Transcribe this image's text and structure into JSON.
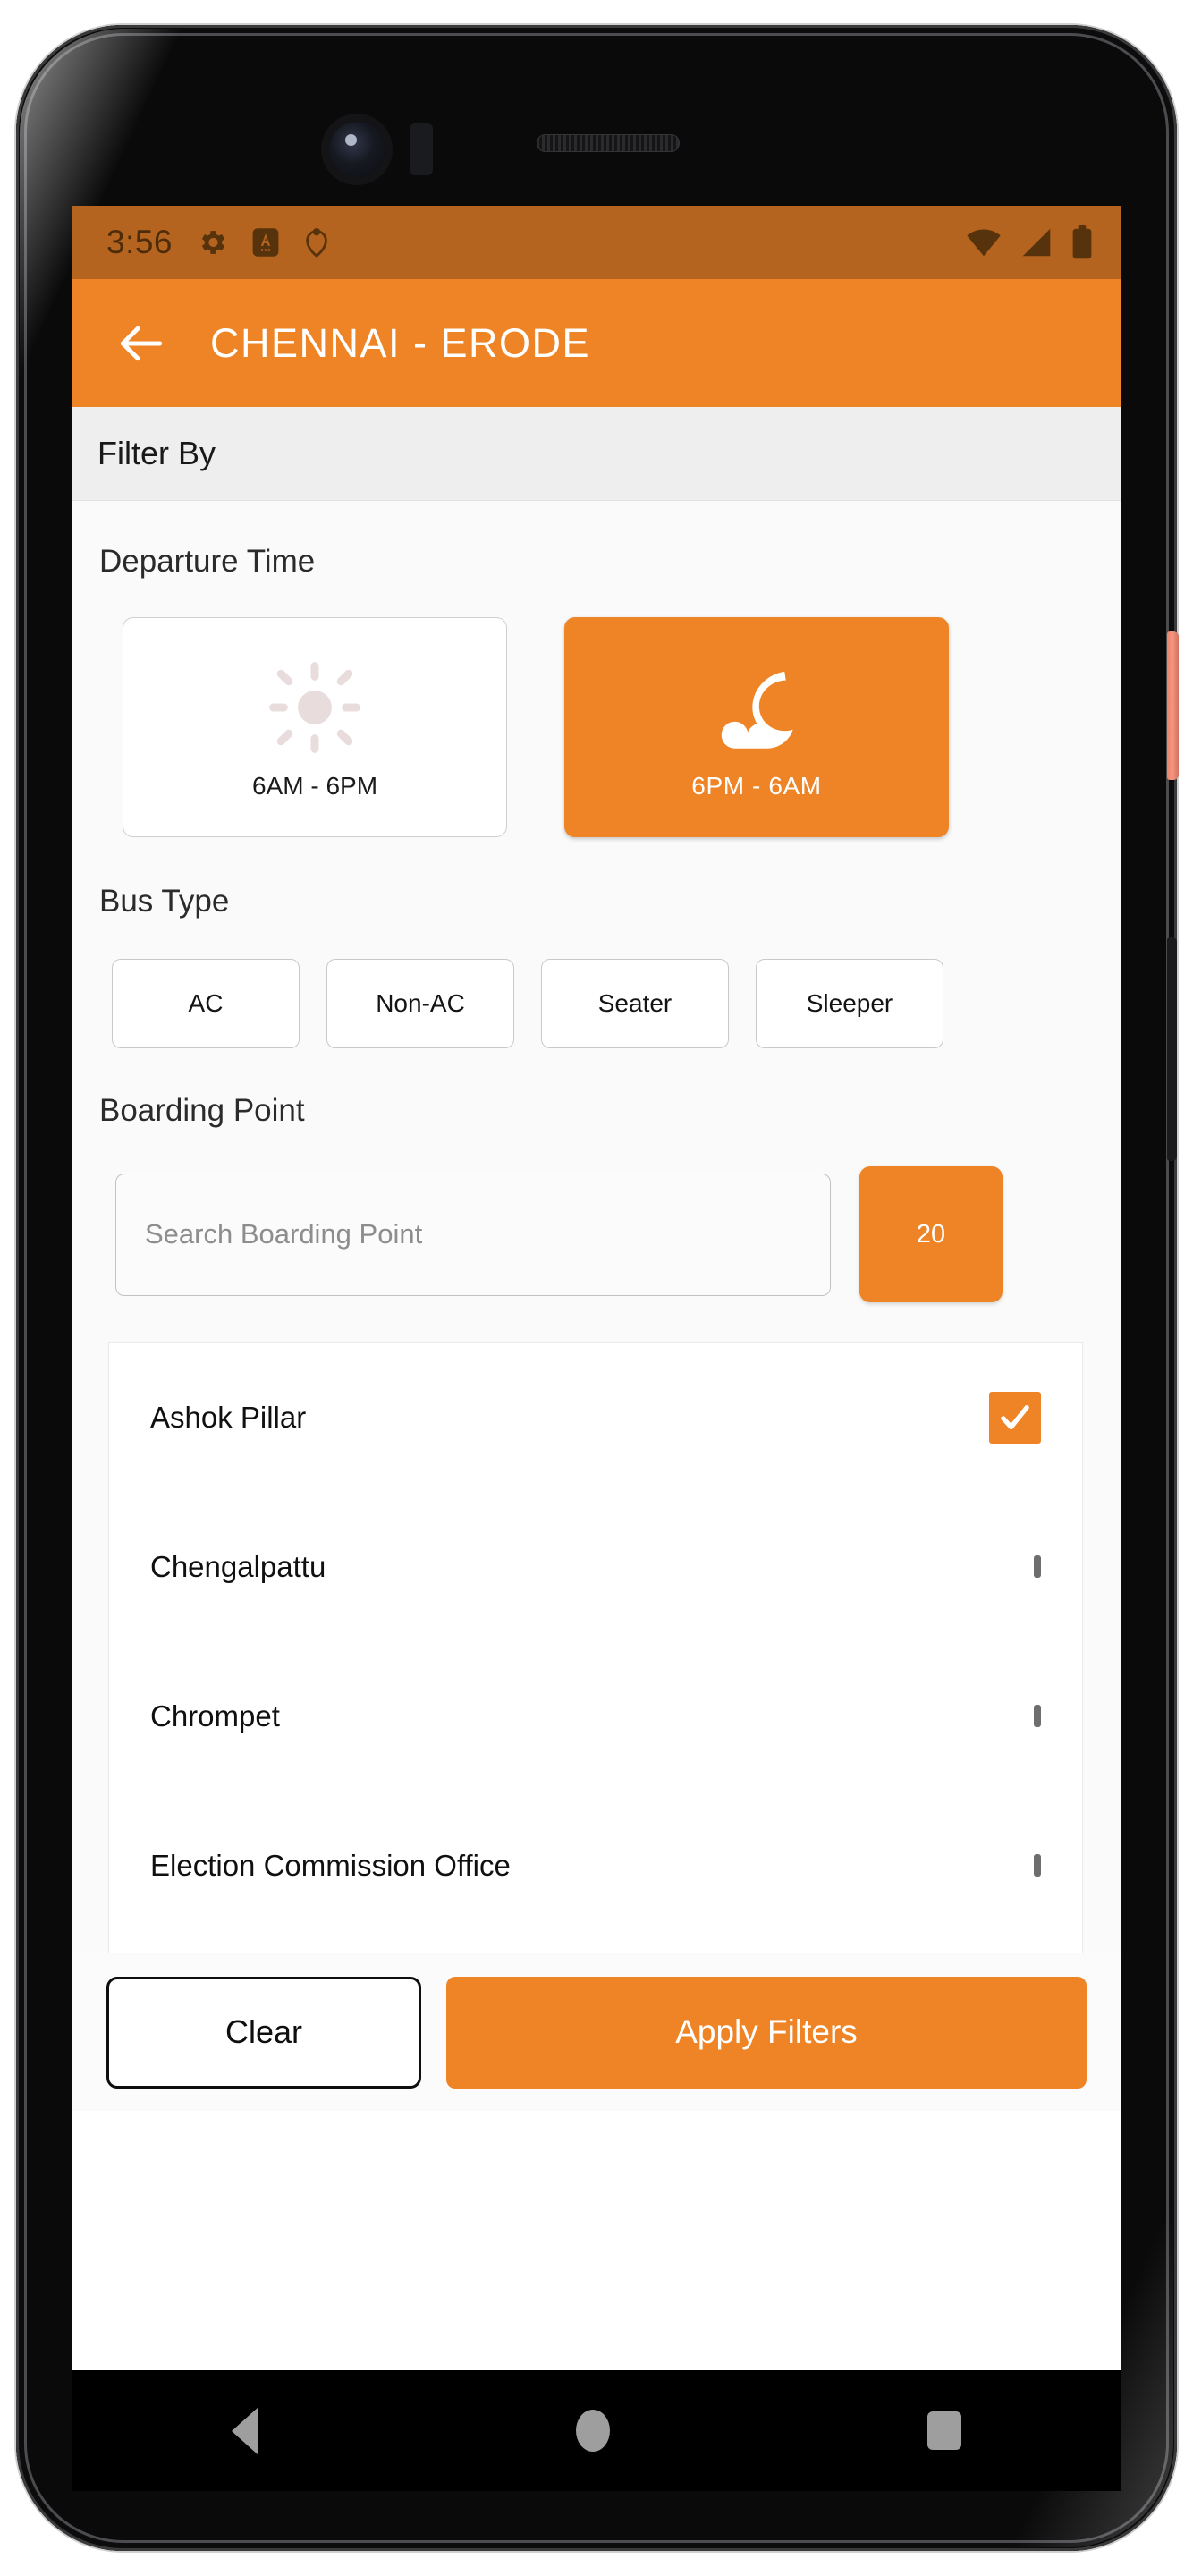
{
  "status_bar": {
    "time": "3:56",
    "left_icons": [
      "gear-icon",
      "android-auto-icon",
      "person-pin-icon"
    ],
    "right_icons": [
      "wifi-icon",
      "cellular-signal-icon",
      "battery-icon"
    ],
    "background_color": "#b4641e",
    "icon_color": "#56320d"
  },
  "app_bar": {
    "back_icon": "back-arrow-icon",
    "title": "CHENNAI - ERODE",
    "background_color": "#ee8425",
    "text_color": "#ffffff"
  },
  "filter_header": {
    "label": "Filter By",
    "background_color": "#eeeeee"
  },
  "departure_time": {
    "section_label": "Departure Time",
    "options": [
      {
        "label": "6AM - 6PM",
        "icon": "sun-icon",
        "selected": false
      },
      {
        "label": "6PM - 6AM",
        "icon": "moon-cloud-icon",
        "selected": true
      }
    ]
  },
  "bus_type": {
    "section_label": "Bus Type",
    "options": [
      {
        "label": "AC",
        "selected": false
      },
      {
        "label": "Non-AC",
        "selected": false
      },
      {
        "label": "Seater",
        "selected": false
      },
      {
        "label": "Sleeper",
        "selected": false
      }
    ]
  },
  "boarding_point": {
    "section_label": "Boarding Point",
    "search_placeholder": "Search Boarding Point",
    "search_value": "",
    "count_badge": "20",
    "items": [
      {
        "name": "Ashok Pillar",
        "checked": true
      },
      {
        "name": "Chengalpattu",
        "checked": false
      },
      {
        "name": "Chrompet",
        "checked": false
      },
      {
        "name": "Election Commission Office",
        "checked": false
      }
    ]
  },
  "actions": {
    "clear_label": "Clear",
    "apply_label": "Apply Filters",
    "accent_color": "#ee8425"
  },
  "nav_bar": {
    "buttons": [
      "back-triangle-icon",
      "home-circle-icon",
      "recents-square-icon"
    ]
  }
}
